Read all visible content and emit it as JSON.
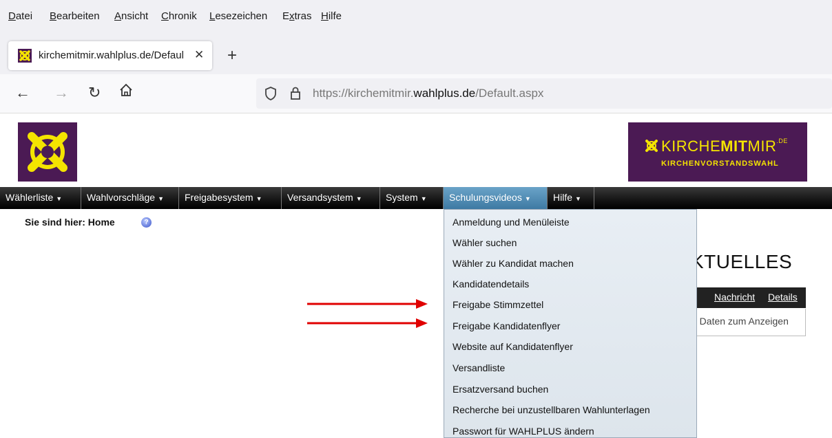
{
  "browser": {
    "menu": [
      {
        "accel": "D",
        "rest": "atei"
      },
      {
        "accel": "B",
        "rest": "earbeiten"
      },
      {
        "accel": "A",
        "rest": "nsicht"
      },
      {
        "accel": "C",
        "rest": "hronik"
      },
      {
        "accel": "L",
        "rest": "esezeichen"
      },
      {
        "accel": "x",
        "pre": "E",
        "rest": "tras"
      },
      {
        "accel": "H",
        "rest": "ilfe"
      }
    ],
    "tab_title": "kirchemitmir.wahlplus.de/Default.aspx",
    "url": {
      "scheme": "https://kirchemitmir.",
      "domain": "wahlplus.de",
      "path": "/Default.aspx"
    }
  },
  "brand": {
    "main_light": "KIRCHE",
    "main_bold": "MIT",
    "main_light2": "MIR",
    "superscript": ".DE",
    "sub": "KIRCHENVORSTANDSWAHL",
    "color_purple": "#4b1a54",
    "color_yellow": "#f4e400"
  },
  "nav": {
    "items": [
      "Wählerliste",
      "Wahlvorschläge",
      "Freigabesystem",
      "Versandsystem",
      "System",
      "Schulungsvideos",
      "Hilfe"
    ],
    "active": "Schulungsvideos"
  },
  "breadcrumb": "Sie sind hier: Home",
  "dropdown": {
    "items": [
      "Anmeldung und Menüleiste",
      "Wähler suchen",
      "Wähler zu Kandidat machen",
      "Kandidatendetails",
      "Freigabe Stimmzettel",
      "Freigabe Kandidatenflyer",
      "Website auf Kandidatenflyer",
      "Versandliste",
      "Ersatzversand buchen",
      "Recherche bei unzustellbaren Wahlunterlagen",
      "Passwort für WAHLPLUS ändern"
    ]
  },
  "news": {
    "heading": "KTUELLES",
    "columns": [
      "Nachricht",
      "Details"
    ],
    "empty": "e Daten zum Anzeigen"
  }
}
